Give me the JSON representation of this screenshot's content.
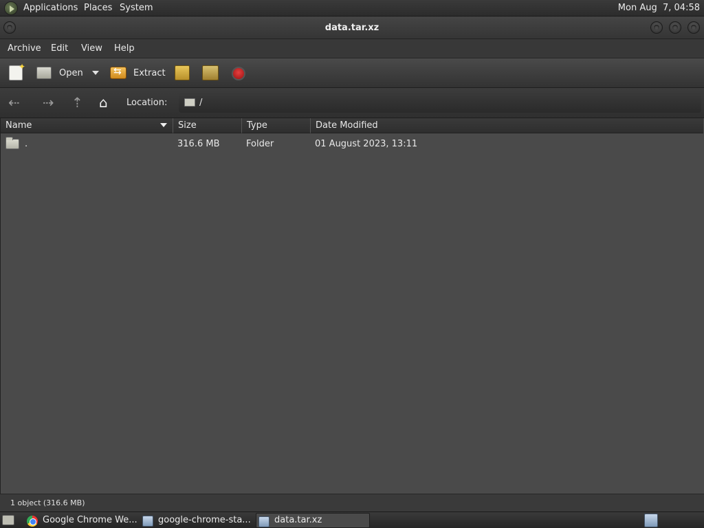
{
  "top_panel": {
    "menus": [
      "Applications",
      "Places",
      "System"
    ],
    "clock": "Mon Aug  7, 04:58"
  },
  "window": {
    "title": "data.tar.xz"
  },
  "menubar": {
    "items": [
      "Archive",
      "Edit",
      "View",
      "Help"
    ]
  },
  "toolbar": {
    "open_label": "Open",
    "extract_label": "Extract"
  },
  "location": {
    "label": "Location:",
    "path": "/"
  },
  "file_list": {
    "columns": [
      "Name",
      "Size",
      "Type",
      "Date Modified"
    ],
    "rows": [
      {
        "name": ".",
        "size": "316.6 MB",
        "type": "Folder",
        "date_modified": "01 August 2023, 13:11"
      }
    ]
  },
  "status": {
    "text": "1 object (316.6 MB)"
  },
  "taskbar": {
    "tasks": [
      "Google Chrome We...",
      "google-chrome-sta...",
      "data.tar.xz"
    ]
  }
}
